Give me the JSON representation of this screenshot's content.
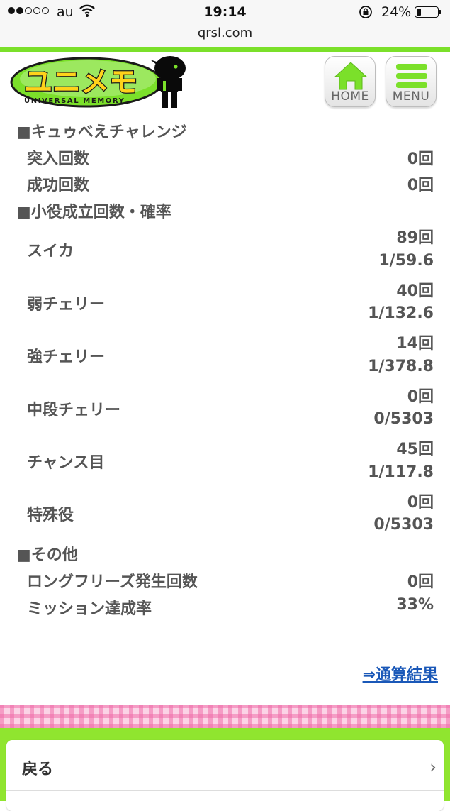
{
  "status_bar": {
    "carrier": "au",
    "time": "19:14",
    "battery": "24%",
    "battery_level": 0.24,
    "url": "qrsl.com"
  },
  "header": {
    "logo_text": "ユニメモ",
    "logo_subtext": "UNIVERSAL MEMORY",
    "home_label": "HOME",
    "menu_label": "MENU"
  },
  "sections": {
    "kyubey": {
      "title": "■キュゥべえチャレンジ",
      "rows": [
        {
          "label": "突入回数",
          "value": "0回"
        },
        {
          "label": "成功回数",
          "value": "0回"
        }
      ]
    },
    "koyaku": {
      "title": "■小役成立回数・確率",
      "rows": [
        {
          "label": "スイカ",
          "count": "89回",
          "prob": "1/59.6"
        },
        {
          "label": "弱チェリー",
          "count": "40回",
          "prob": "1/132.6"
        },
        {
          "label": "強チェリー",
          "count": "14回",
          "prob": "1/378.8"
        },
        {
          "label": "中段チェリー",
          "count": "0回",
          "prob": "0/5303"
        },
        {
          "label": "チャンス目",
          "count": "45回",
          "prob": "1/117.8"
        },
        {
          "label": "特殊役",
          "count": "0回",
          "prob": "0/5303"
        }
      ]
    },
    "other": {
      "title": "■その他",
      "rows": [
        {
          "label": "ロングフリーズ発生回数",
          "value": "0回"
        },
        {
          "label": "ミッション達成率",
          "value": "33%"
        }
      ]
    }
  },
  "link": {
    "total_results": "⇒通算結果"
  },
  "footer": {
    "back_label": "戻る",
    "chevron": "›"
  },
  "colors": {
    "accent_green": "#7be02a",
    "link_blue": "#1a58b8",
    "plaid_pink": "#f06eaa"
  }
}
